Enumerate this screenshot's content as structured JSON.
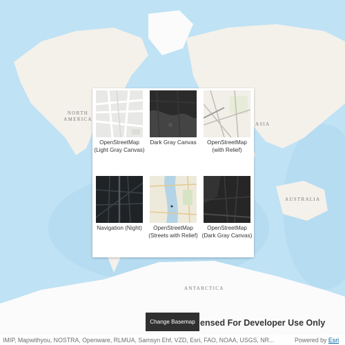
{
  "map": {
    "labels": {
      "north_america": "NORTH\nAMERICA",
      "asia": "ASIA",
      "australia": "AUSTRALIA",
      "antarctica": "ANTARCTICA"
    }
  },
  "gallery": {
    "items": [
      {
        "label": "OpenStreetMap (Light Gray Canvas)",
        "thumb": "light-gray-canvas"
      },
      {
        "label": "Dark Gray Canvas",
        "thumb": "dark-gray-canvas"
      },
      {
        "label": "OpenStreetMap (with Relief)",
        "thumb": "osm-relief"
      },
      {
        "label": "Navigation (Night)",
        "thumb": "navigation-night"
      },
      {
        "label": "OpenStreetMap (Streets with Relief)",
        "thumb": "osm-streets-relief"
      },
      {
        "label": "OpenStreetMap (Dark Gray Canvas)",
        "thumb": "osm-dark-gray"
      }
    ]
  },
  "controls": {
    "change_basemap": "Change Basemap"
  },
  "watermark": "ensed For Developer Use Only",
  "attribution": {
    "text": "IMIP, Mapwithyou, NOSTRA, Openware, RLMUA, Samsyn Ehf, VZD, Esri, FAO, NOAA, USGS, NR...",
    "powered_by": "Powered by",
    "powered_link": "Esri"
  },
  "colors": {
    "ocean": "#bfe2f5",
    "land": "#f4f1ea",
    "ice": "#fbfbfb",
    "button_bg": "#303030",
    "link": "#0067a3"
  }
}
